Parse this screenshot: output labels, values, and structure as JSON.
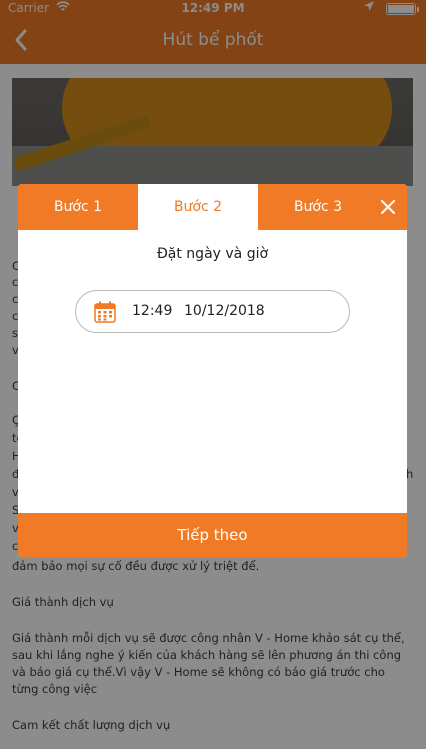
{
  "status": {
    "carrier": "Carrier",
    "time": "12:49 PM"
  },
  "nav": {
    "title": "Hút bể phốt",
    "back_icon": "chevron-left-icon"
  },
  "content": {
    "partial_lines_left": [
      "C",
      "c",
      "c",
      "c",
      "s",
      "v",
      "C",
      "Ç",
      "te",
      "H",
      "đ",
      "v",
      "S",
      "v",
      "c"
    ],
    "partial_right": "h",
    "para_end": "đảm bảo mọi sự cố đều được xử lý triệt để.",
    "section_price_title": "Giá thành dịch vụ",
    "price_text": "Giá thành mỗi dịch vụ sẽ được công nhân V - Home khảo sát cụ thể, sau khi lắng nghe ý kiến của khách hàng sẽ lên phương án thi công và báo giá cụ thể.Vì vậy V - Home sẽ không có báo giá trước cho từng công việc",
    "section_quality_title": "Cam kết chất lượng dịch vụ"
  },
  "modal": {
    "tabs": [
      "Bước 1",
      "Bước 2",
      "Bước 3"
    ],
    "active_tab": 1,
    "heading": "Đặt ngày và giờ",
    "time": "12:49",
    "date": "10/12/2018",
    "next_label": "Tiếp theo",
    "close_icon": "close-icon",
    "calendar_icon": "calendar-icon"
  },
  "colors": {
    "accent": "#f07a25"
  }
}
